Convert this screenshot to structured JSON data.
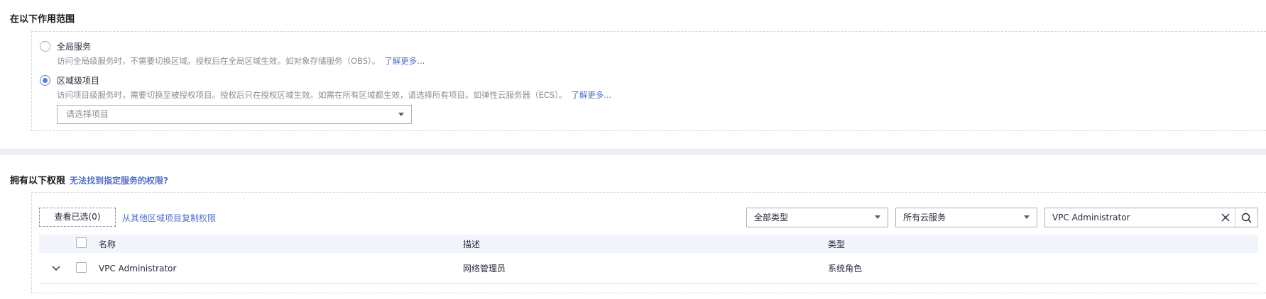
{
  "scope": {
    "title": "在以下作用范围",
    "options": [
      {
        "label": "全局服务",
        "checked": false,
        "description": "访问全局级服务时，不需要切换区域。授权后在全局区域生效。如对象存储服务（OBS）。",
        "more_link": "了解更多..."
      },
      {
        "label": "区域级项目",
        "checked": true,
        "description": "访问项目级服务时，需要切换至被授权项目。授权后只在授权区域生效。如需在所有区域都生效，请选择所有项目。如弹性云服务器（ECS）。",
        "more_link": "了解更多..."
      }
    ],
    "project_select_placeholder": "请选择项目"
  },
  "permissions": {
    "title": "拥有以下权限",
    "help_link": "无法找到指定服务的权限?",
    "view_selected_button": "查看已选(0)",
    "copy_link": "从其他区域项目复制权限",
    "type_filter": "全部类型",
    "service_filter": "所有云服务",
    "search_value": "VPC Administrator",
    "table": {
      "headers": {
        "name": "名称",
        "description": "描述",
        "type": "类型"
      },
      "rows": [
        {
          "name": "VPC Administrator",
          "description": "网络管理员",
          "type": "系统角色",
          "checked": false
        }
      ]
    }
  },
  "icons": {
    "caret": "caret-down-icon",
    "clear": "close-icon",
    "search": "search-icon",
    "expand": "chevron-down-icon"
  },
  "colors": {
    "accent": "#5e7ce0",
    "link": "#526ecc",
    "muted_text": "#8a8e99",
    "header_bg": "#f2f5fc"
  }
}
